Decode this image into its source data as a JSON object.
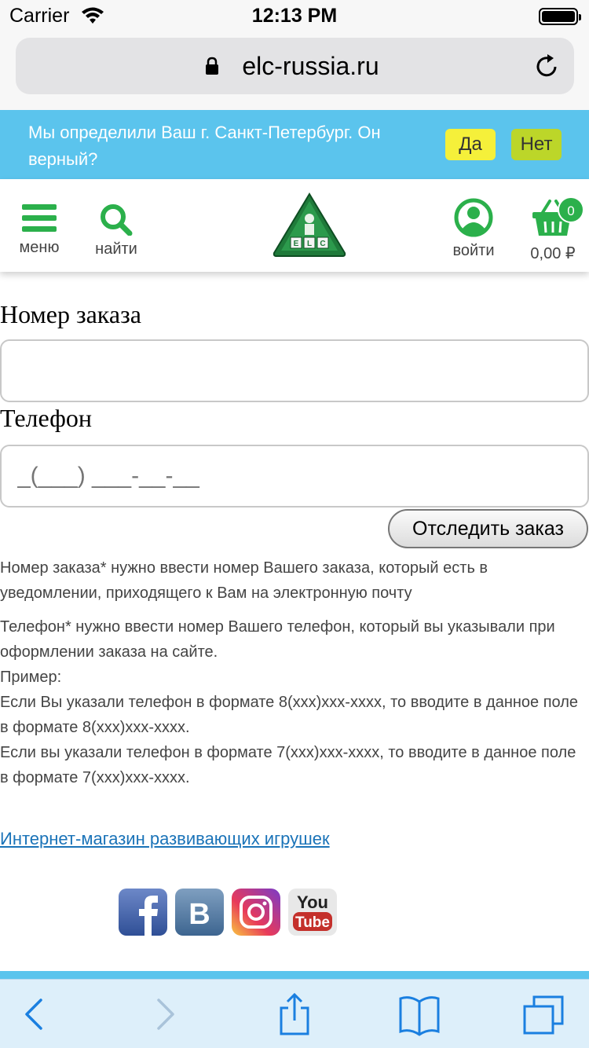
{
  "status": {
    "carrier": "Carrier",
    "time": "12:13 PM"
  },
  "browser": {
    "url": "elc-russia.ru"
  },
  "banner": {
    "message": "Мы определили Ваш г. Санкт-Петербург. Он верный?",
    "yes_label": "Да",
    "no_label": "Нет"
  },
  "header": {
    "menu_label": "меню",
    "search_label": "найти",
    "login_label": "войти",
    "cart_count": "0",
    "cart_total": "0,00 ₽"
  },
  "form": {
    "order_label": "Номер заказа",
    "order_value": "",
    "phone_label": "Телефон",
    "phone_placeholder": "_(___) ___-__-__",
    "track_button": "Отследить заказ"
  },
  "info": {
    "order_help": "Номер заказа* нужно ввести номер Вашего заказа, который есть в уведомлении, приходящего к Вам на электронную почту",
    "phone_help_1": "Телефон* нужно ввести номер Вашего телефон, который вы указывали при оформлении заказа на сайте.",
    "example_label": "Пример:",
    "example_1": "Если Вы указали телефон в формате 8(xxx)xxx-xxxx, то вводите в данное поле в формате 8(xxx)xxx-xxxx.",
    "example_2": "Если вы указали телефон в формате 7(xxx)xxx-xxxx, то вводите в данное поле в формате 7(xxx)xxx-xxxx."
  },
  "footer": {
    "shop_link": "Интернет-магазин развивающих игрушек",
    "social": [
      "facebook-icon",
      "vk-icon",
      "instagram-icon",
      "youtube-icon"
    ],
    "youtube_text_top": "You",
    "youtube_text_bottom": "Tube",
    "vk_letter": "B"
  },
  "logo_text": "ELC",
  "colors": {
    "accent_green": "#2bb04b",
    "banner_blue": "#5bc4ed",
    "yes_yellow": "#f5f03a",
    "no_green": "#bcd629"
  }
}
